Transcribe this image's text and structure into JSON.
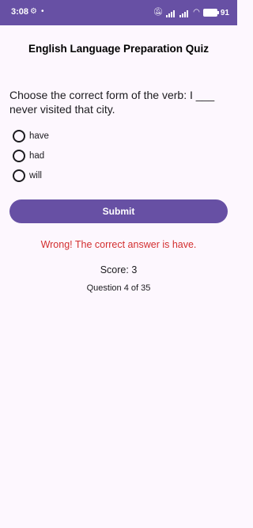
{
  "status_bar": {
    "time": "3:08",
    "battery": "91",
    "icons": [
      "settings-icon",
      "mute-icon",
      "signal-icon",
      "wifi-icon",
      "battery-icon"
    ]
  },
  "quiz": {
    "title": "English Language Preparation Quiz",
    "question": "Choose the correct form of the verb: I ___ never visited that city.",
    "options": [
      {
        "label": "have",
        "selected": false
      },
      {
        "label": "had",
        "selected": false
      },
      {
        "label": "will",
        "selected": false
      }
    ],
    "submit_label": "Submit",
    "feedback": "Wrong! The correct answer is have.",
    "score_text": "Score: 3",
    "progress_text": "Question 4 of 35"
  },
  "colors": {
    "primary": "#6750a4",
    "background": "#fdf7fe",
    "error": "#d32f2f",
    "text": "#1c1b1f"
  }
}
